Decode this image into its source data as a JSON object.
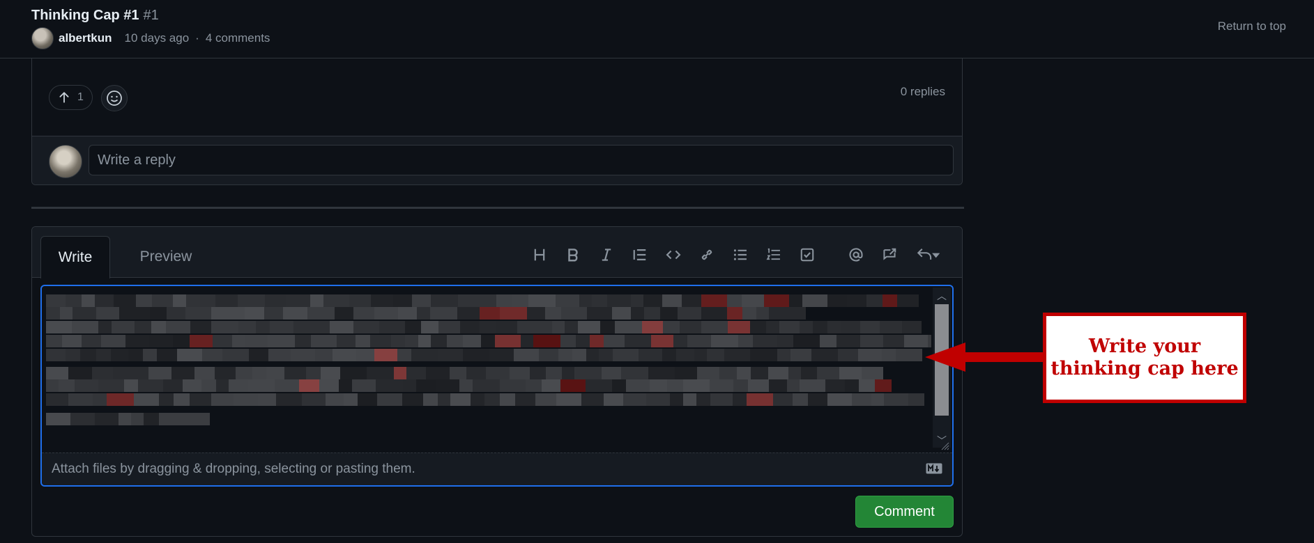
{
  "header": {
    "title": "Thinking Cap #1",
    "number": "#1",
    "author": "albertkun",
    "time": "10 days ago",
    "separator": "·",
    "comments": "4 comments",
    "return_to_top": "Return to top"
  },
  "reply_card": {
    "upvotes": "1",
    "replies": "0 replies",
    "reply_placeholder": "Write a reply"
  },
  "editor": {
    "tabs": {
      "write": "Write",
      "preview": "Preview"
    },
    "toolbar_icons": [
      "heading-icon",
      "bold-icon",
      "italic-icon",
      "quote-icon",
      "code-icon",
      "link-icon",
      "bulleted-list-icon",
      "numbered-list-icon",
      "task-list-icon",
      "mention-icon",
      "reference-icon",
      "reply-icon"
    ],
    "attach_text": "Attach files by dragging & dropping, selecting or pasting them.",
    "comment_button": "Comment",
    "accent_color": "#1f6feb",
    "button_color": "#238636"
  },
  "annotation": {
    "text": "Write your thinking cap here",
    "color": "#c00000"
  }
}
